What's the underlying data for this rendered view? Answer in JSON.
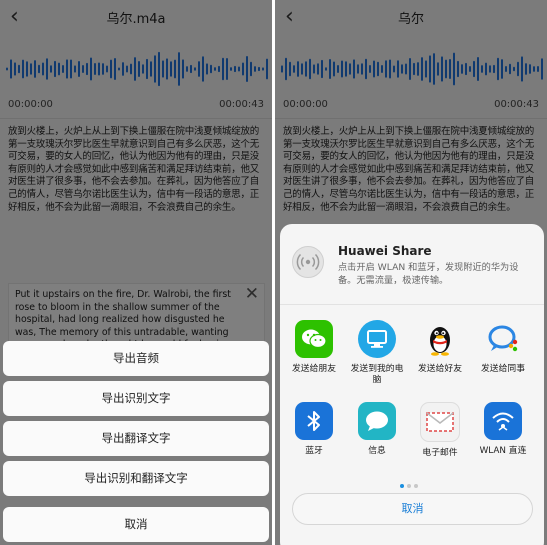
{
  "left": {
    "title": "乌尔.m4a",
    "time_start": "00:00:00",
    "time_end": "00:00:43",
    "transcript": "放到火楼上，火炉上从上到下换上僵服在院中浅夏倾城绽放的第一支玫瑰沃尔罗比医生早就意识到自己有多么厌恶，这个无可交易，要的女人的回忆，他认为他因为他有的理由，只是没有原则的人才会感觉如此中感到痛苦和满足拜访结束前，他又对医生讲了很多事，他不会去参加。在葬礼，因为他答应了自己的情人，尽管乌尔诺比医生认为，信中有一段话的意思，正好相反，他不会为此留一滴眼泪，不会浪费自己的余生。",
    "translation": "Put it upstairs on the fire, Dr. Walrobi, the first rose to bloom in the shallow summer of the hospital, had long realized how disgusted he was, The memory of this untradable, wanting woman, whom he thought he could feel pain and contentment from for reasons he had only",
    "close_glyph": "✕",
    "actions": [
      "导出音频",
      "导出识别文字",
      "导出翻译文字",
      "导出识别和翻译文字"
    ],
    "cancel": "取消"
  },
  "right": {
    "title": "乌尔",
    "time_start": "00:00:00",
    "time_end": "00:00:43",
    "transcript": "放到火楼上，火炉上从上到下换上僵服在院中浅夏倾城绽放的第一支玫瑰沃尔罗比医生早就意识到自己有多么厌恶，这个无可交易，要的女人的回忆，他认为他因为他有的理由，只是没有原则的人才会感觉如此中感到痛苦和满足拜访结束前，他又对医生讲了很多事，他不会去参加。在葬礼，因为他答应了自己的情人，尽管乌尔诺比医生认为，信中有一段话的意思，正好相反，他不会为此留一滴眼泪，不会浪费自己的余生。",
    "share": {
      "huawei_share_title": "Huawei Share",
      "huawei_share_desc": "点击开启 WLAN 和蓝牙，发现附近的华为设备。无需流量，极速传输。",
      "apps": [
        {
          "label": "发送给朋友",
          "icon": "wechat-icon",
          "color": "#2dc100"
        },
        {
          "label": "发送到我的电脑",
          "icon": "computer-icon",
          "color": "#22a7e6"
        },
        {
          "label": "发送给好友",
          "icon": "qq-penguin-icon",
          "color": "#ffffff"
        },
        {
          "label": "发送给同事",
          "icon": "work-chat-icon",
          "color": "#ffffff"
        },
        {
          "label": "蓝牙",
          "icon": "bluetooth-icon",
          "color": "#1a73d8"
        },
        {
          "label": "信息",
          "icon": "message-icon",
          "color": "#22b5c5"
        },
        {
          "label": "电子邮件",
          "icon": "mail-icon",
          "color": "#f2f2f2"
        },
        {
          "label": "WLAN 直连",
          "icon": "wlan-direct-icon",
          "color": "#1a73d8"
        }
      ],
      "cancel": "取消"
    }
  },
  "accent": "#1a7ed6",
  "waveform_color": "#1f6fd6"
}
